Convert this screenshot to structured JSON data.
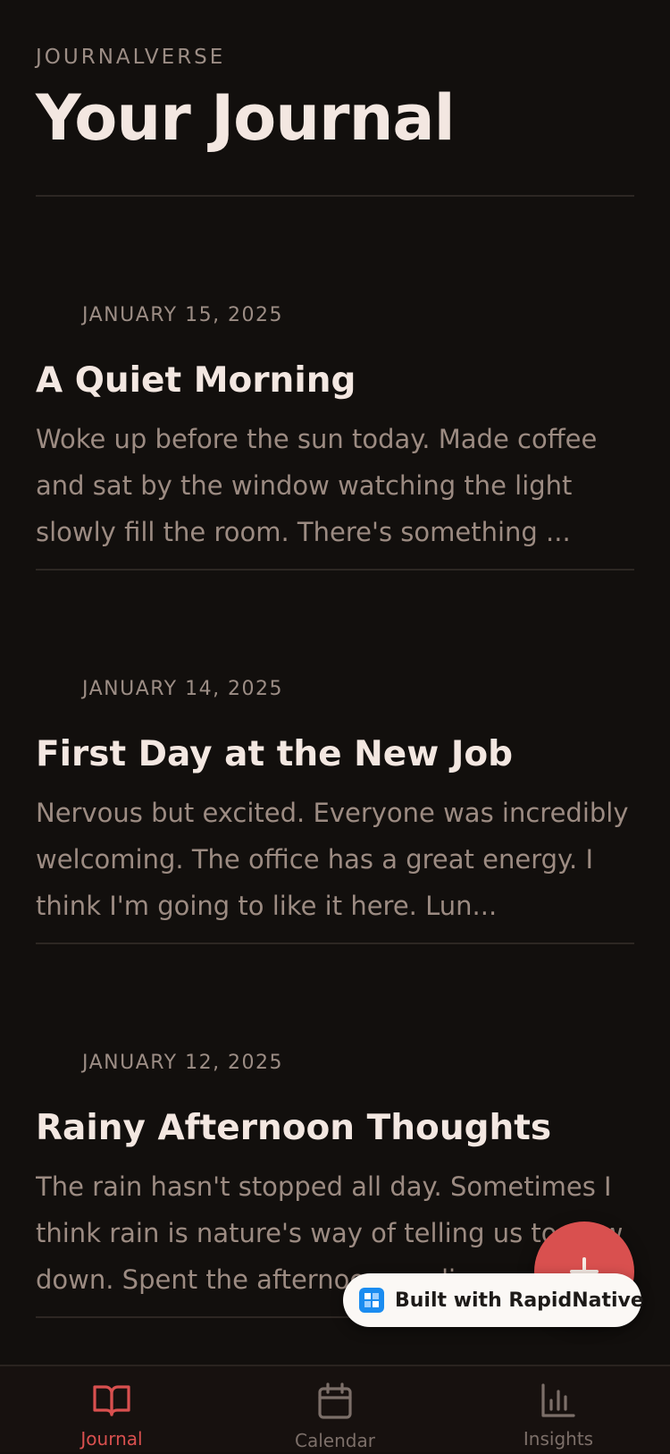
{
  "header": {
    "brand": "JOURNALVERSE",
    "title": "Your Journal"
  },
  "entries": [
    {
      "date": "JANUARY 15, 2025",
      "title": "A Quiet Morning",
      "preview": "Woke up before the sun today. Made coffee and sat by the window watching the light slowly fill the room. There's something ..."
    },
    {
      "date": "JANUARY 14, 2025",
      "title": "First Day at the New Job",
      "preview": "Nervous but excited. Everyone was incredibly welcoming. The office has a great energy. I think I'm going to like it here. Lun..."
    },
    {
      "date": "JANUARY 12, 2025",
      "title": "Rainy Afternoon Thoughts",
      "preview": "The rain hasn't stopped all day. Sometimes I think rain is nature's way of telling us to slow down. Spent the afternoon reading..."
    }
  ],
  "badge": {
    "label": "Built with RapidNative"
  },
  "tabs": [
    {
      "label": "Journal",
      "icon": "book-open-icon",
      "active": true
    },
    {
      "label": "Calendar",
      "icon": "calendar-icon",
      "active": false
    },
    {
      "label": "Insights",
      "icon": "bar-chart-icon",
      "active": false
    }
  ],
  "colors": {
    "background": "#120f0d",
    "accent": "#d9504f",
    "text_primary": "#f3e7e1",
    "text_secondary": "#9c8b82"
  }
}
